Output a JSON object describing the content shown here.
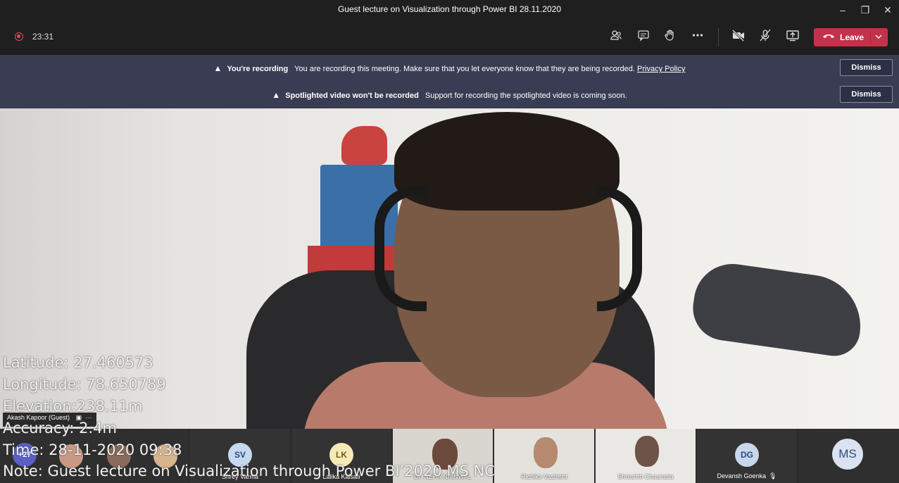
{
  "window": {
    "title": "Guest lecture on Visualization through Power BI 28.11.2020",
    "minimize_icon": "–",
    "maximize_icon": "❐",
    "close_icon": "✕"
  },
  "toolbar": {
    "timer": "23:31",
    "leave_label": "Leave",
    "icons": [
      "participants-icon",
      "chat-icon",
      "raise-hand-icon",
      "more-options-icon",
      "camera-off-icon",
      "mic-off-icon",
      "share-screen-icon"
    ]
  },
  "banners": [
    {
      "title": "You're recording",
      "text": "You are recording this meeting. Make sure that you let everyone know that they are being recorded.",
      "link": "Privacy Policy",
      "button": "Dismiss"
    },
    {
      "title": "Spotlighted video won't be recorded",
      "text": "Support for recording the spotlighted video is coming soon.",
      "button": "Dismiss"
    }
  ],
  "main_video": {
    "name": "Akash Kapoor (Guest)",
    "more": "···"
  },
  "geo_overlay": {
    "latitude_label": "Latitude:",
    "latitude": "27.460573",
    "longitude_label": "Longitude:",
    "longitude": "78.650789",
    "elevation_label": "Elevation:",
    "elevation": "238.11m",
    "accuracy_label": "Accuracy:",
    "accuracy": "2.4m",
    "time_label": "Time:",
    "time": "28-11-2020 09:38",
    "note_label": "Note:",
    "note": "Guest lecture on Visualization through Power BI’2020 MS NC"
  },
  "participants": [
    {
      "overflow_count": "+27"
    },
    {
      "initials": "SV",
      "name": "Shrey Varma",
      "color": "#c7d9ef"
    },
    {
      "initials": "LK",
      "name": "Lalika Kalsati",
      "color": "#f6e9b8"
    },
    {
      "name": "Dr. NEHA NAINWAL"
    },
    {
      "name": "Richika Vashisht"
    },
    {
      "name": "Shreshth Chaurasia"
    },
    {
      "initials": "DG",
      "name": "Devansh Goenka",
      "color": "#c9d7ea"
    },
    {
      "initials": "MS",
      "color": "#dbe3f0"
    }
  ]
}
